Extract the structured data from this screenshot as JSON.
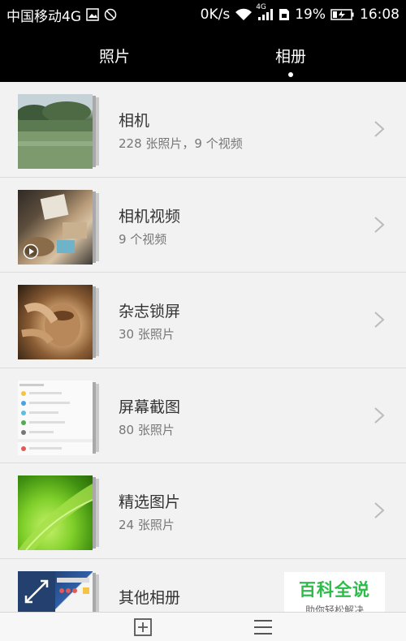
{
  "status_bar": {
    "carrier": "中国移动4G",
    "network_speed": "0K/s",
    "network_type": "4G",
    "battery_percent": "19%",
    "time": "16:08"
  },
  "tabs": [
    {
      "label": "照片",
      "active": false
    },
    {
      "label": "相册",
      "active": true
    }
  ],
  "albums": [
    {
      "title": "相机",
      "count": "228 张照片，9 个视频",
      "thumb": "landscape"
    },
    {
      "title": "相机视频",
      "count": "9 个视频",
      "thumb": "video"
    },
    {
      "title": "杂志锁屏",
      "count": "30 张照片",
      "thumb": "pottery"
    },
    {
      "title": "屏幕截图",
      "count": "80 张照片",
      "thumb": "screenshot"
    },
    {
      "title": "精选图片",
      "count": "24 张照片",
      "thumb": "leaf"
    },
    {
      "title": "其他相册",
      "count": "",
      "thumb": "other"
    }
  ],
  "watermark": {
    "title": "百科全说",
    "subtitle": "助你轻松解决"
  },
  "bottom_bar": {
    "add_icon": "add-album-icon",
    "menu_icon": "menu-icon"
  },
  "colors": {
    "header_bg": "#000000",
    "list_bg": "#f2f2f2",
    "watermark_green": "#2dbb4a"
  }
}
